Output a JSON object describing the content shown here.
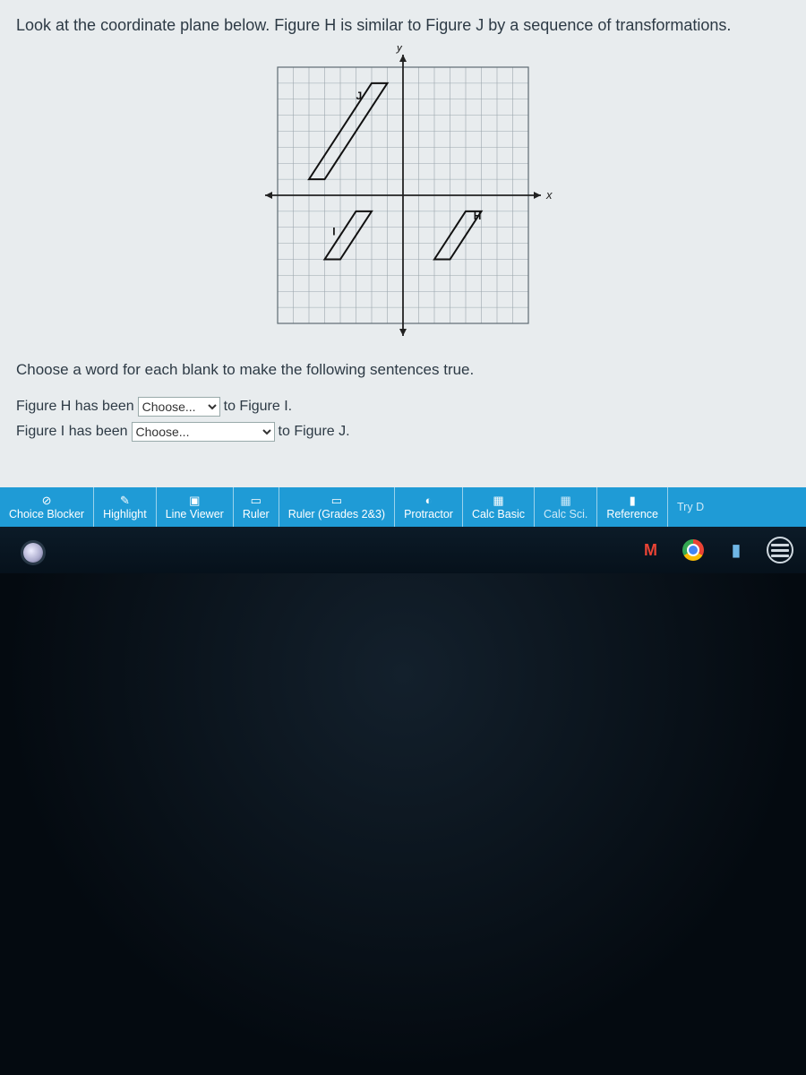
{
  "prompt": "Look at the coordinate plane below. Figure H is similar to Figure J by a sequence of transformations.",
  "instruction": "Choose a word for each blank to make the following sentences true.",
  "axis": {
    "x": "x",
    "y": "y"
  },
  "figure_labels": {
    "J": "J",
    "I": "I",
    "H": "H"
  },
  "sentences": {
    "s1_pre": "Figure H has been",
    "s1_post": "to Figure I.",
    "s2_pre": "Figure I has been",
    "s2_post": "to Figure J."
  },
  "dropdown_placeholder": "Choose...",
  "toolbar": {
    "choice_blocker": "Choice Blocker",
    "highlight": "Highlight",
    "line_viewer": "Line Viewer",
    "ruler": "Ruler",
    "ruler23": "Ruler (Grades 2&3)",
    "protractor": "Protractor",
    "calc_basic": "Calc Basic",
    "calc_sci": "Calc Sci.",
    "reference": "Reference",
    "try": "Try D"
  },
  "chart_data": {
    "type": "scatter",
    "title": "Coordinate plane with three similar parallelograms",
    "xlabel": "x",
    "ylabel": "y",
    "xlim": [
      -8,
      8
    ],
    "ylim": [
      -8,
      8
    ],
    "grid": true,
    "series": [
      {
        "name": "J",
        "type": "polygon",
        "points": [
          [
            -6,
            1
          ],
          [
            -2,
            7
          ],
          [
            -1,
            7
          ],
          [
            -5,
            1
          ]
        ],
        "label_pos": [
          -3,
          6
        ]
      },
      {
        "name": "I",
        "type": "polygon",
        "points": [
          [
            -5,
            -4
          ],
          [
            -3,
            -1
          ],
          [
            -2,
            -1
          ],
          [
            -4,
            -4
          ]
        ],
        "label_pos": [
          -4.5,
          -2.5
        ]
      },
      {
        "name": "H",
        "type": "polygon",
        "points": [
          [
            2,
            -4
          ],
          [
            4,
            -1
          ],
          [
            5,
            -1
          ],
          [
            3,
            -4
          ]
        ],
        "label_pos": [
          4.5,
          -1.5
        ]
      }
    ]
  }
}
